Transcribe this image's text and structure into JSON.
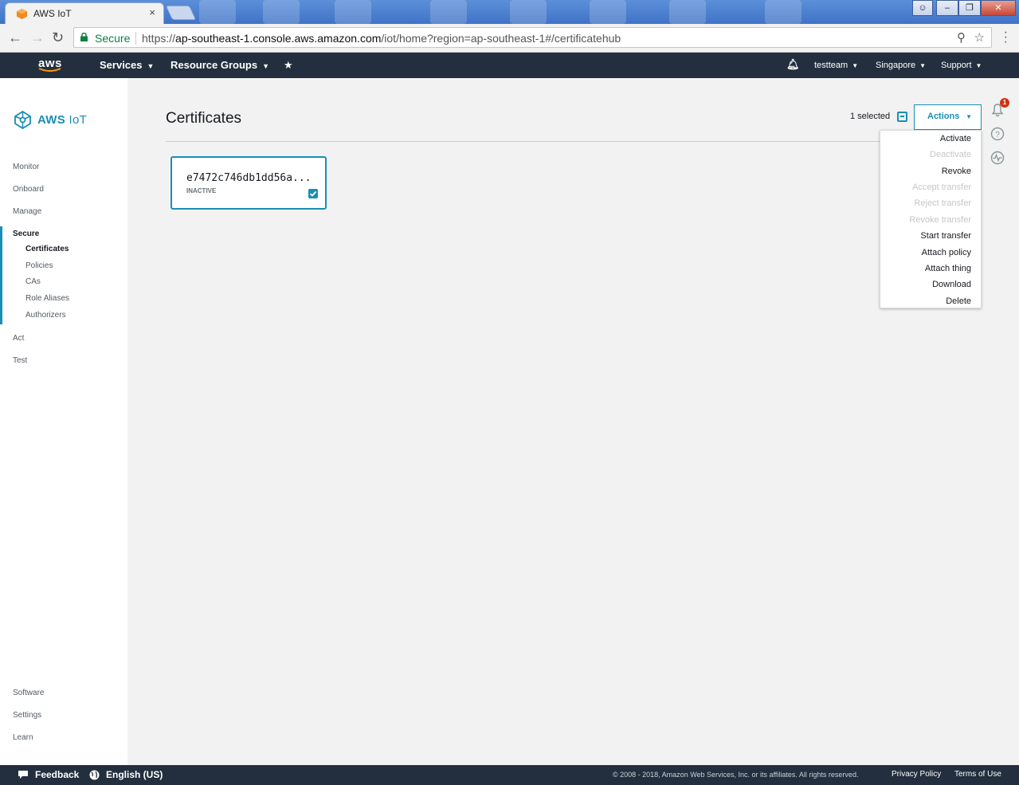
{
  "browser": {
    "tab_title": "AWS IoT",
    "tab_close": "×",
    "secure_label": "Secure",
    "url_scheme": "https://",
    "url_host": "ap-southeast-1.console.aws.amazon.com",
    "url_path": "/iot/home?region=ap-southeast-1#/certificatehub"
  },
  "topnav": {
    "logo": "aws",
    "services": "Services",
    "resource_groups": "Resource Groups",
    "user": "testteam",
    "region": "Singapore",
    "support": "Support"
  },
  "sidebar": {
    "brand": "AWS",
    "brand_suffix": "IoT",
    "items": {
      "monitor": "Monitor",
      "onboard": "Onboard",
      "manage": "Manage",
      "secure": "Secure",
      "act": "Act",
      "test": "Test",
      "software": "Software",
      "settings": "Settings",
      "learn": "Learn"
    },
    "secure_sub": [
      "Certificates",
      "Policies",
      "CAs",
      "Role Aliases",
      "Authorizers"
    ]
  },
  "main": {
    "title": "Certificates",
    "selected_text": "1 selected",
    "actions_label": "Actions",
    "actions_menu": [
      {
        "label": "Activate",
        "enabled": true
      },
      {
        "label": "Deactivate",
        "enabled": false
      },
      {
        "label": "Revoke",
        "enabled": true
      },
      {
        "label": "Accept transfer",
        "enabled": false
      },
      {
        "label": "Reject transfer",
        "enabled": false
      },
      {
        "label": "Revoke transfer",
        "enabled": false
      },
      {
        "label": "Start transfer",
        "enabled": true
      },
      {
        "label": "Attach policy",
        "enabled": true
      },
      {
        "label": "Attach thing",
        "enabled": true
      },
      {
        "label": "Download",
        "enabled": true
      },
      {
        "label": "Delete",
        "enabled": true
      }
    ],
    "certificate": {
      "id": "e7472c746db1dd56a...",
      "status": "INACTIVE",
      "checked": true
    },
    "notification_count": "1"
  },
  "footer": {
    "feedback": "Feedback",
    "language": "English (US)",
    "copyright": "© 2008 - 2018, Amazon Web Services, Inc. or its affiliates. All rights reserved.",
    "privacy": "Privacy Policy",
    "terms": "Terms of Use"
  },
  "colors": {
    "accent": "#1a8eb4",
    "nav_bg": "#232f3e",
    "badge": "#d13212"
  }
}
